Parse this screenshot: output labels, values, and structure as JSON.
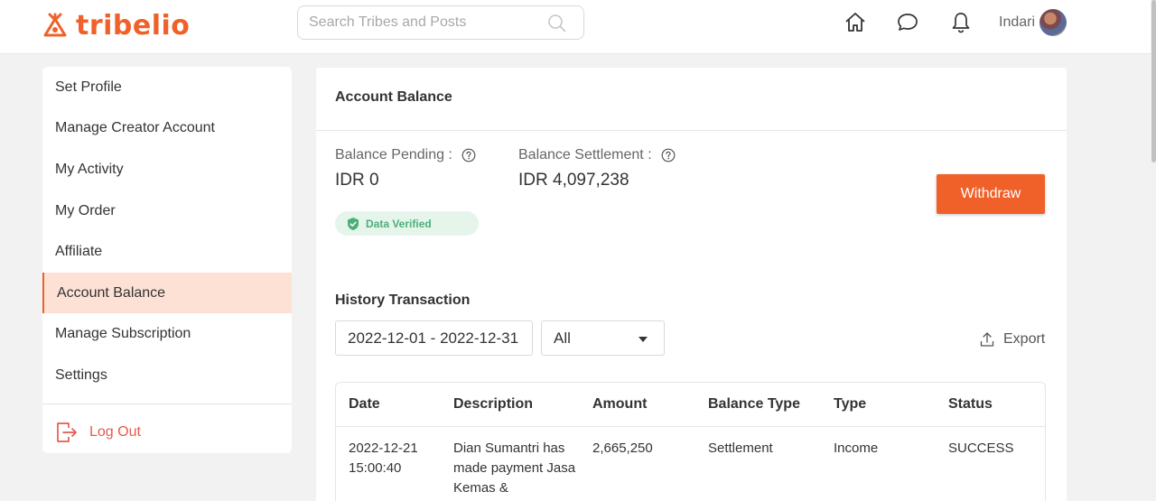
{
  "header": {
    "logo_text": "tribelio",
    "search_placeholder": "Search Tribes and Posts",
    "user_name": "Indari"
  },
  "sidebar": {
    "items": [
      {
        "label": "Set Profile"
      },
      {
        "label": "Manage Creator Account"
      },
      {
        "label": "My Activity"
      },
      {
        "label": "My Order"
      },
      {
        "label": "Affiliate"
      },
      {
        "label": "Account Balance"
      },
      {
        "label": "Manage Subscription"
      },
      {
        "label": "Settings"
      }
    ],
    "active_item": "Account Balance",
    "logout_label": "Log Out"
  },
  "main": {
    "title": "Account Balance",
    "balance_pending_label": "Balance Pending :",
    "balance_pending_value": "IDR 0",
    "balance_settlement_label": "Balance Settlement :",
    "balance_settlement_value": "IDR 4,097,238",
    "verified_label": "Data Verified",
    "withdraw_label": "Withdraw",
    "history_title": "History Transaction",
    "date_range": "2022-12-01 - 2022-12-31",
    "filter_value": "All",
    "export_label": "Export",
    "table": {
      "headers": [
        "Date",
        "Description",
        "Amount",
        "Balance Type",
        "Type",
        "Status"
      ],
      "rows": [
        {
          "date": "2022-12-21 15:00:40",
          "description": "Dian Sumantri has made payment Jasa Kemas &",
          "amount": "2,665,250",
          "balance_type": "Settlement",
          "type": "Income",
          "status": "SUCCESS"
        }
      ]
    }
  },
  "colors": {
    "brand": "#f0612a",
    "active_bg": "#fde1d4",
    "verified_bg": "#e6f5ec",
    "verified_text": "#4caf79",
    "logout": "#e55a4e"
  }
}
